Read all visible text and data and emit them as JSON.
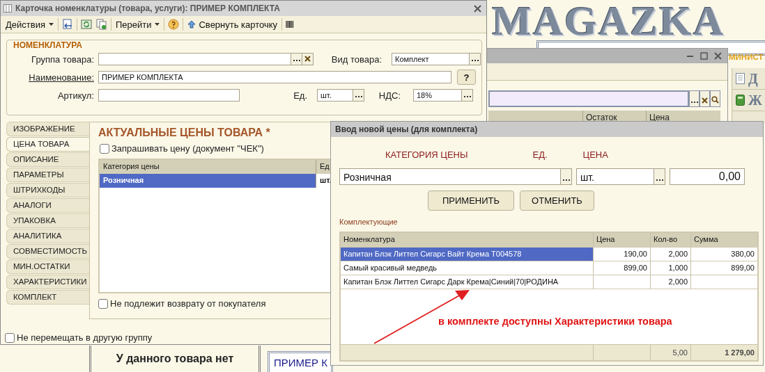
{
  "logo": {
    "text": "MAGAZKA"
  },
  "back_window": {
    "section_label": "МИНИСТ",
    "columns": [
      "Остаток",
      "Цена"
    ],
    "side_items": [
      "Д",
      "Ж"
    ]
  },
  "card_window": {
    "title": "Карточка номенклатуры (товара, услуги): ПРИМЕР КОМПЛЕКТА",
    "toolbar": [
      {
        "kind": "menu",
        "label": "Действия"
      },
      {
        "kind": "save"
      },
      {
        "kind": "refresh"
      },
      {
        "kind": "copy"
      },
      {
        "kind": "menu",
        "label": "Перейти"
      },
      {
        "kind": "help"
      },
      {
        "kind": "collapse",
        "label": "Свернуть карточку"
      },
      {
        "kind": "barcode"
      }
    ],
    "group": {
      "title": "НОМЕНКЛАТУРА",
      "group_label": "Группа товара:",
      "type_label": "Вид товара:",
      "type_value": "Комплект",
      "name_label": "Наименование:",
      "name_value": "ПРИМЕР КОМПЛЕКТА",
      "help_button": "?",
      "article_label": "Артикул:",
      "unit_label": "Ед.",
      "unit_value": "шт.",
      "vat_label": "НДС:",
      "vat_value": "18%"
    },
    "tabs": [
      {
        "label": "ИЗОБРАЖЕНИЕ",
        "selected": false
      },
      {
        "label": "ЦЕНА ТОВАРА",
        "selected": true
      },
      {
        "label": "ОПИСАНИЕ",
        "selected": false
      },
      {
        "label": "ПАРАМЕТРЫ",
        "selected": false
      },
      {
        "label": "ШТРИХКОДЫ",
        "selected": false
      },
      {
        "label": "АНАЛОГИ",
        "selected": false
      },
      {
        "label": "УПАКОВКА",
        "selected": false
      },
      {
        "label": "АНАЛИТИКА",
        "selected": false
      },
      {
        "label": "СОВМЕСТИМОСТЬ",
        "selected": false
      },
      {
        "label": "МИН.ОСТАТКИ",
        "selected": false
      },
      {
        "label": "ХАРАКТЕРИСТИКИ",
        "selected": false
      },
      {
        "label": "КОМПЛЕКТ",
        "selected": false
      }
    ],
    "prices": {
      "heading": "АКТУАЛЬНЫЕ ЦЕНЫ ТОВАРА *",
      "ask_price": {
        "label": "Запрашивать цену (документ \"ЧЕК\")",
        "checked": false
      },
      "columns": [
        "Категория цены",
        "Ед"
      ],
      "rows": [
        {
          "cells": [
            "Розничная",
            "шт."
          ],
          "selected": true
        }
      ],
      "no_return": {
        "label": "Не подлежит возврату от покупателя",
        "checked": false
      }
    },
    "no_move": {
      "label": "Не перемещать в другую группу",
      "checked": false
    }
  },
  "bottom": {
    "no_image_text": "У данного товара нет",
    "name_preview": "ПРИМЕР К"
  },
  "dialog": {
    "title": "Ввод новой цены (для комплекта)",
    "headers": [
      "КАТЕГОРИЯ ЦЕНЫ",
      "ЕД.",
      "ЦЕНА"
    ],
    "category": "Розничная",
    "unit": "шт.",
    "price": "0,00",
    "buttons": [
      "ПРИМЕНИТЬ",
      "ОТМЕНИТЬ"
    ],
    "section": "Комплектующие",
    "columns": [
      "Номенклатура",
      "Цена",
      "Кол-во",
      "Сумма"
    ],
    "rows": [
      {
        "cells": [
          "Капитан Блэк Литтел Сигарс Вайт Крема T004578",
          "190,00",
          "2,000",
          "380,00"
        ],
        "selected": true
      },
      {
        "cells": [
          "Самый красивый медведь",
          "899,00",
          "1,000",
          "899,00"
        ],
        "selected": false
      },
      {
        "cells": [
          "Капитан Блэк Литтел Сигарс Дарк Крема|Синий|70|РОДИНА",
          "",
          "2,000",
          ""
        ],
        "selected": false
      }
    ],
    "footer": {
      "quantity": "5,00",
      "total": "1 279,00"
    }
  },
  "annotation": {
    "text": "в комплекте доступны Характеристики товара"
  }
}
